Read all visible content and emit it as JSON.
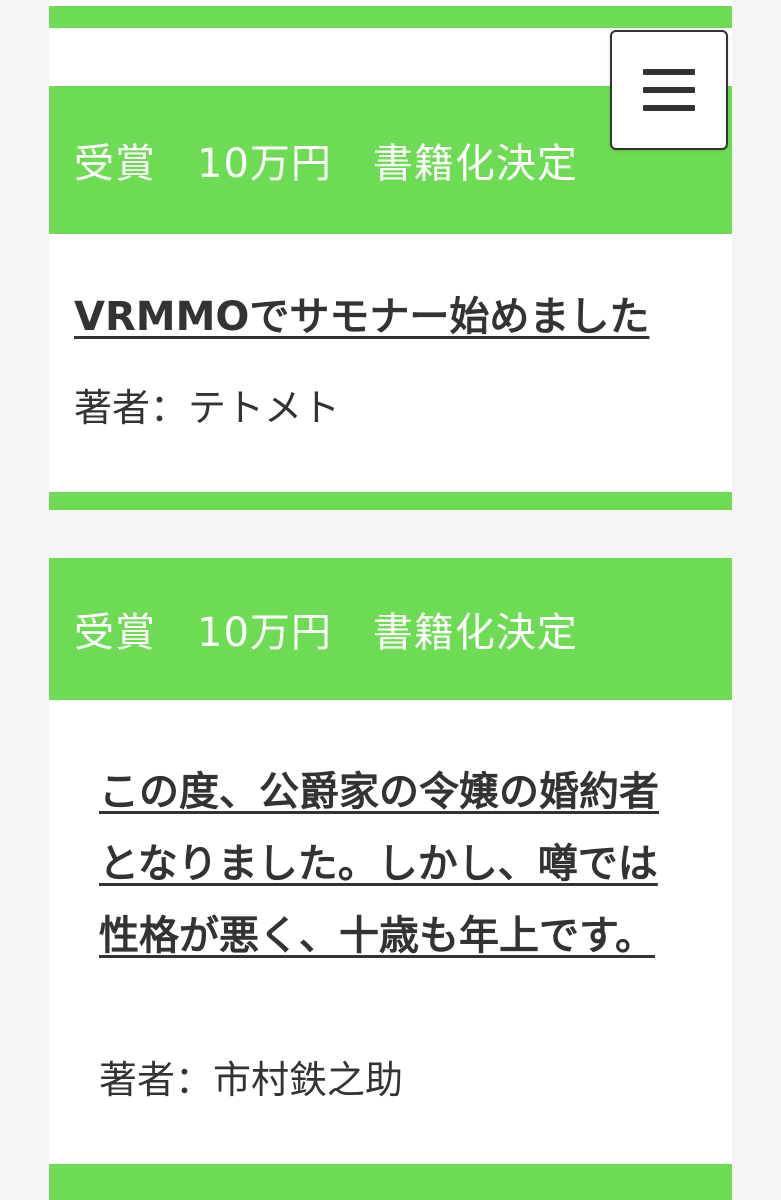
{
  "theme": {
    "accent": "#6ddc54",
    "text": "#333333",
    "header_text": "#ffffff",
    "background": "#f5f5f5"
  },
  "menu": {
    "icon": "hamburger-menu-icon"
  },
  "entries": [
    {
      "award": "受賞　10万円　書籍化決定",
      "title": "VRMMOでサモナー始めました",
      "author": "著者：テトメト"
    },
    {
      "award": "受賞　10万円　書籍化決定",
      "title": "この度、公爵家の令嬢の婚約者となりました。しかし、噂では性格が悪く、十歳も年上です。",
      "author": "著者：市村鉄之助"
    }
  ]
}
